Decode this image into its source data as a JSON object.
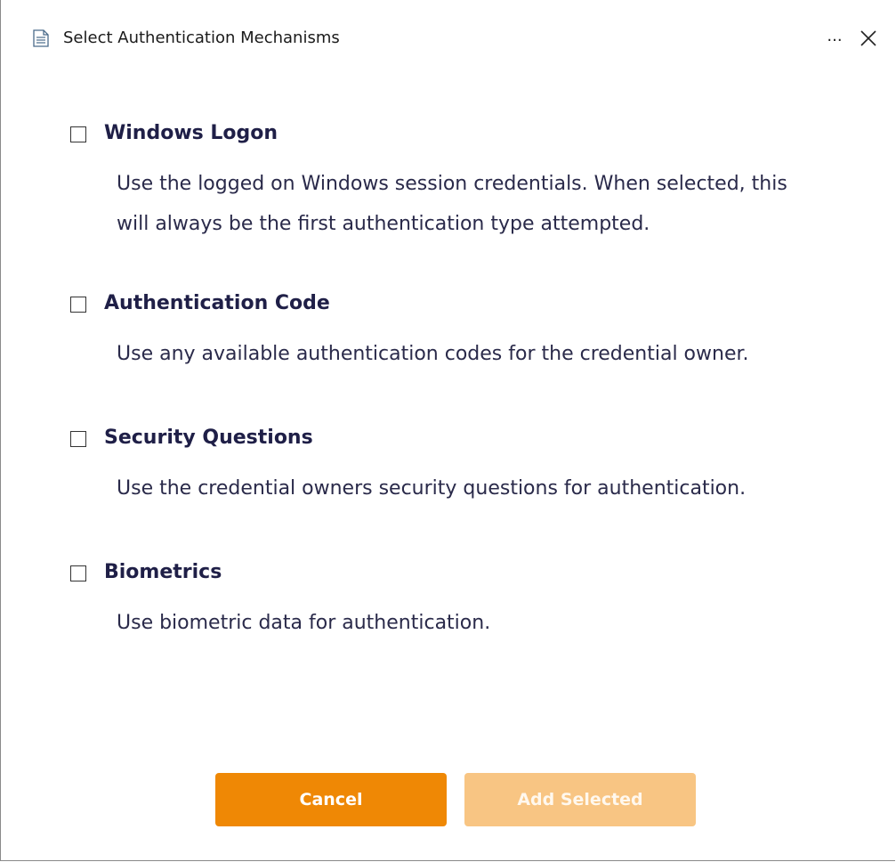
{
  "window": {
    "title": "Select Authentication Mechanisms",
    "more_label": "...",
    "title_icon": "document-icon",
    "close_icon": "close-icon"
  },
  "options": [
    {
      "label": "Windows Logon",
      "description": "Use the logged on Windows session credentials. When selected, this will always be the first authentication type attempted.",
      "checked": false
    },
    {
      "label": "Authentication Code",
      "description": "Use any available authentication codes for the credential owner.",
      "checked": false
    },
    {
      "label": "Security Questions",
      "description": "Use the credential owners security questions for authentication.",
      "checked": false
    },
    {
      "label": "Biometrics",
      "description": "Use biometric data for authentication.",
      "checked": false
    }
  ],
  "footer": {
    "cancel_label": "Cancel",
    "add_label": "Add Selected",
    "add_enabled": false
  },
  "colors": {
    "accent": "#ef8805",
    "accent_disabled": "#f8c583",
    "heading_text": "#1f1f47"
  }
}
